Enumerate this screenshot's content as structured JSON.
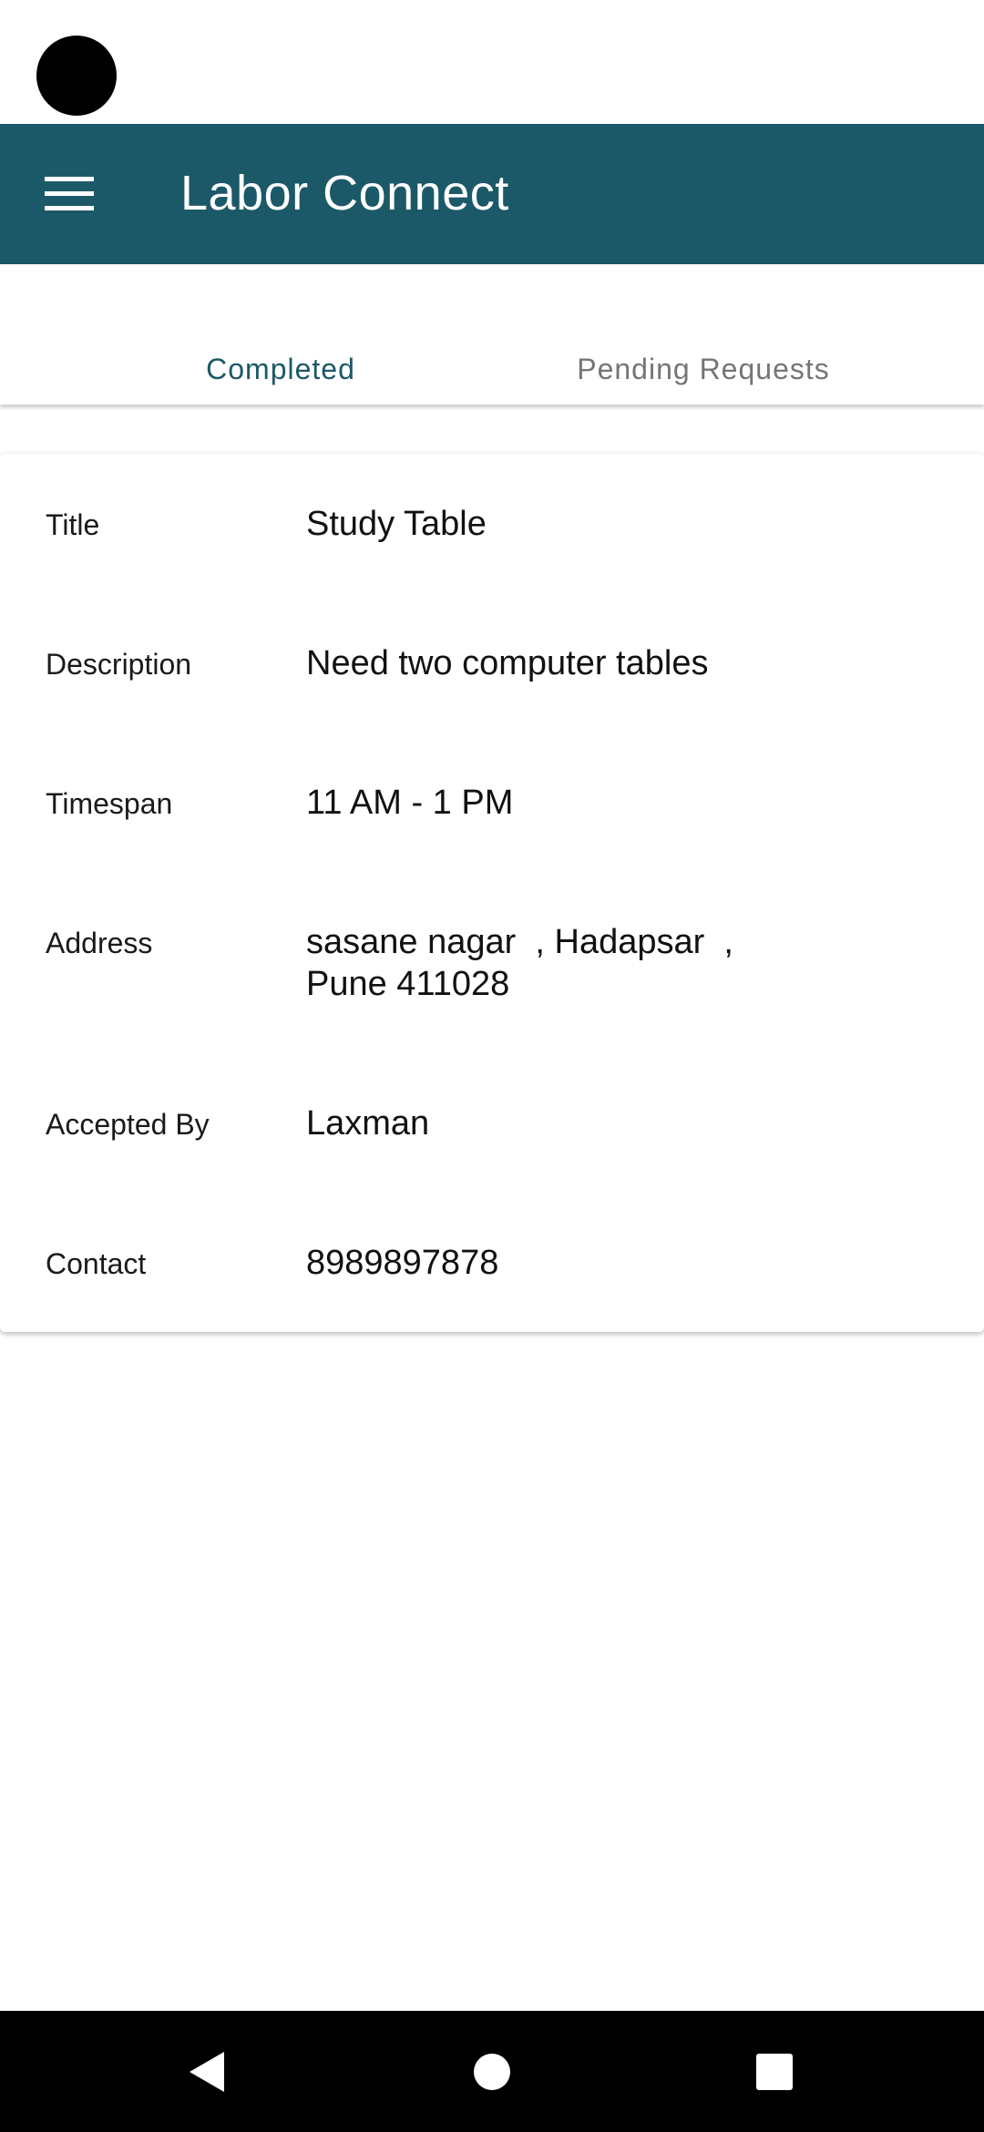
{
  "app": {
    "title": "Labor Connect"
  },
  "tabs": [
    {
      "label": "Completed",
      "selected": true
    },
    {
      "label": "Pending Requests",
      "selected": false
    }
  ],
  "card": {
    "rows": [
      {
        "label": "Title",
        "value": "Study Table"
      },
      {
        "label": "Description",
        "value": "Need two computer tables"
      },
      {
        "label": "Timespan",
        "value": "11 AM - 1 PM"
      },
      {
        "label": "Address",
        "value": "sasane nagar  , Hadapsar  ,\nPune 411028"
      },
      {
        "label": "Accepted By",
        "value": "Laxman"
      },
      {
        "label": "Contact",
        "value": "8989897878"
      }
    ]
  },
  "icons": {
    "menu": "hamburger-menu-icon",
    "back": "back-triangle-icon",
    "home": "home-circle-icon",
    "recent": "recent-apps-square-icon"
  },
  "colors": {
    "app_bar": "#1c5968",
    "tab_selected": "#1c5968",
    "tab_unselected": "#757575",
    "nav_bar": "#000000"
  }
}
